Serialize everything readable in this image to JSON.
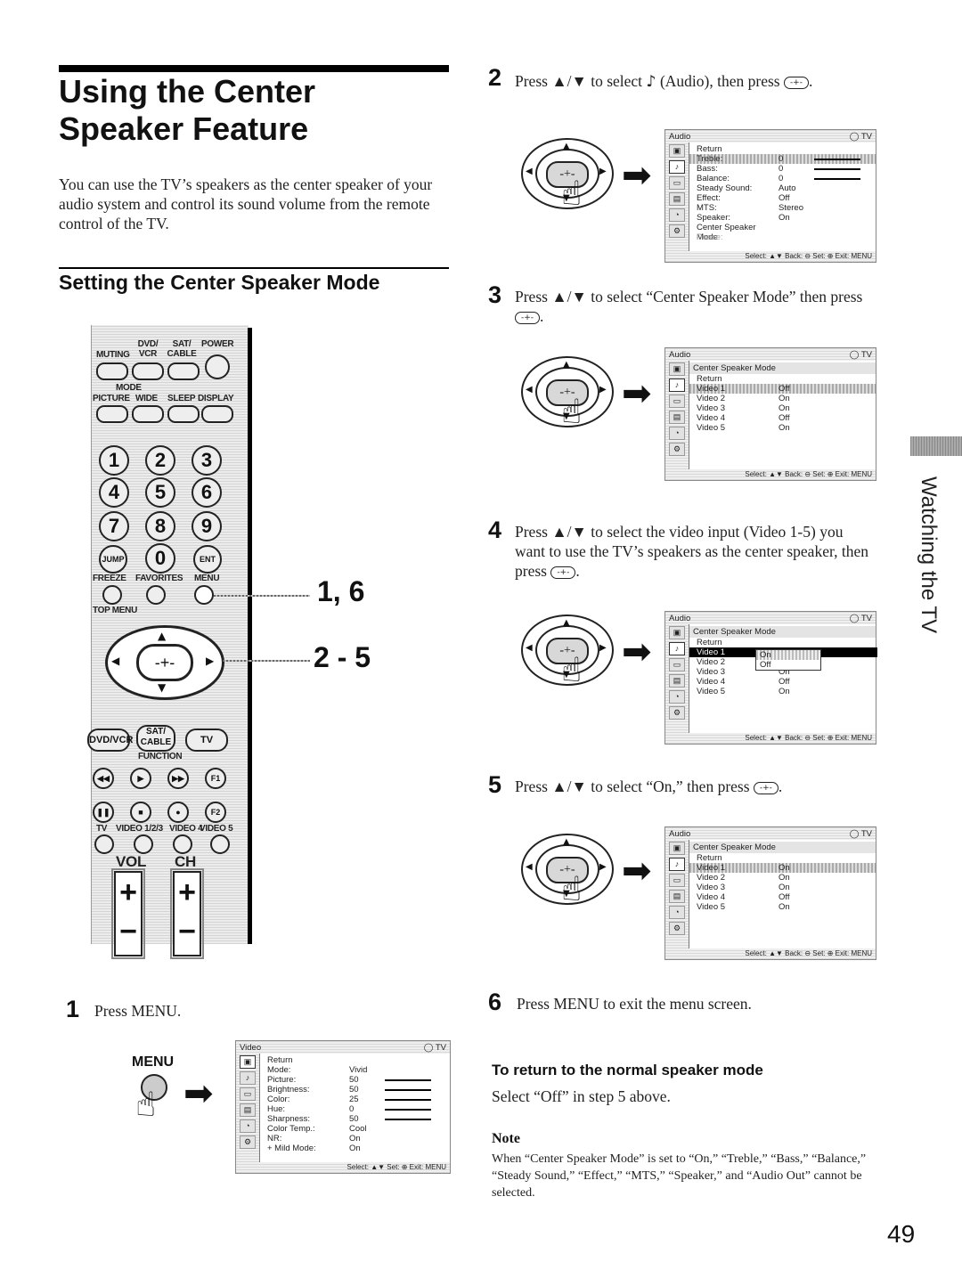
{
  "header": {
    "title_line1": "Using the Center",
    "title_line2": "Speaker Feature",
    "intro": "You can use the TV’s speakers as the center speaker of your audio system and control its sound volume from the remote control of the TV.",
    "subtitle": "Setting the Center Speaker Mode"
  },
  "remote": {
    "top_labels": [
      "MUTING",
      "DVD/ VCR",
      "SAT/ CABLE",
      "POWER"
    ],
    "mode_label": "MODE",
    "mode_labels": [
      "PICTURE",
      "WIDE",
      "SLEEP",
      "DISPLAY"
    ],
    "numbers": [
      "1",
      "2",
      "3",
      "4",
      "5",
      "6",
      "7",
      "8",
      "9"
    ],
    "jump": "JUMP",
    "zero": "0",
    "ent": "ENT",
    "row_labels": [
      "FREEZE",
      "FAVORITES",
      "MENU"
    ],
    "top_menu": "TOP MENU",
    "function_buttons": [
      "DVD/VCR",
      "SAT/ CABLE",
      "TV"
    ],
    "function_label": "FUNCTION",
    "transport_row1": [
      "◀◀",
      "▶",
      "▶▶",
      "F1"
    ],
    "transport_row2": [
      "❚❚",
      "■",
      "●",
      "F2"
    ],
    "input_labels": [
      "TV",
      "VIDEO 1/2/3",
      "VIDEO 4",
      "VIDEO 5"
    ],
    "vol": "VOL",
    "ch": "CH",
    "plus": "+",
    "minus": "−",
    "enter_glyph": "-+-",
    "arrows": {
      "up": "▲",
      "down": "▼",
      "left": "◀",
      "right": "▶"
    }
  },
  "callouts": [
    "1, 6",
    "2 - 5"
  ],
  "steps": [
    {
      "num": "1",
      "text": "Press MENU."
    },
    {
      "num": "2",
      "pre": "Press ▲/▼ to select",
      "icon": "♪",
      "post": "(Audio), then press",
      "end": "."
    },
    {
      "num": "3",
      "text": "Press ▲/▼ to select “Center Speaker Mode” then press",
      "end": "."
    },
    {
      "num": "4",
      "text": "Press ▲/▼ to select the video input (Video 1-5) you want to use the TV’s speakers as the center speaker, then press",
      "end": "."
    },
    {
      "num": "5",
      "text": "Press ▲/▼ to select “On,” then press",
      "end": "."
    },
    {
      "num": "6",
      "text": "Press MENU to exit the menu screen."
    }
  ],
  "menu_button_label": "MENU",
  "enter_glyph": "-+-",
  "hand_glyph": "☝",
  "arrow_glyph": "➡",
  "screens": {
    "video": {
      "header": "Video",
      "tv": "◯ TV",
      "rows": [
        {
          "k": "Return",
          "v": ""
        },
        {
          "k": "Mode:",
          "v": "Vivid"
        },
        {
          "k": "  Picture:",
          "v": "50",
          "bar": true
        },
        {
          "k": "  Brightness:",
          "v": "50",
          "bar": true
        },
        {
          "k": "  Color:",
          "v": "25",
          "bar": true
        },
        {
          "k": "  Hue:",
          "v": "0",
          "bar": true
        },
        {
          "k": "  Sharpness:",
          "v": "50",
          "bar": true
        },
        {
          "k": "  Color Temp.:",
          "v": "Cool"
        },
        {
          "k": "  NR:",
          "v": "On"
        },
        {
          "k": "+ Mild Mode:",
          "v": "On"
        }
      ],
      "footer": "Select: ▲▼  Set: ⊕  Exit: MENU"
    },
    "audio": {
      "header": "Audio",
      "tv": "◯ TV",
      "rows": [
        {
          "k": "Return",
          "v": ""
        },
        {
          "k": "Treble:",
          "v": "0",
          "bar": true,
          "hl": true
        },
        {
          "k": "Bass:",
          "v": "0",
          "bar": true
        },
        {
          "k": "Balance:",
          "v": "0",
          "bar": true
        },
        {
          "k": "Steady Sound:",
          "v": "Auto"
        },
        {
          "k": "Effect:",
          "v": "Off"
        },
        {
          "k": "MTS:",
          "v": "Stereo"
        },
        {
          "k": "Speaker:",
          "v": "On"
        },
        {
          "k": "Center Speaker Mode",
          "v": ""
        },
        {
          "k": "Phase:",
          "v": "",
          "dim": true
        }
      ],
      "footer": "Select: ▲▼  Back: ⊖  Set: ⊕  Exit: MENU"
    },
    "center_step3": {
      "header": "Audio",
      "tv": "◯ TV",
      "sub": "Center Speaker Mode",
      "rows": [
        {
          "k": "Return",
          "v": ""
        },
        {
          "k": "Video 1",
          "v": "Off",
          "hl": true
        },
        {
          "k": "Video 2",
          "v": "On"
        },
        {
          "k": "Video 3",
          "v": "On"
        },
        {
          "k": "Video 4",
          "v": "Off"
        },
        {
          "k": "Video 5",
          "v": "On"
        }
      ],
      "footer": "Select: ▲▼  Back: ⊖  Set: ⊕  Exit: MENU"
    },
    "center_step4": {
      "header": "Audio",
      "tv": "◯ TV",
      "sub": "Center Speaker Mode",
      "rows": [
        {
          "k": "Return",
          "v": ""
        },
        {
          "k": "Video 1",
          "v": "",
          "sel": true
        },
        {
          "k": "Video 2",
          "v": ""
        },
        {
          "k": "Video 3",
          "v": "On"
        },
        {
          "k": "Video 4",
          "v": "Off"
        },
        {
          "k": "Video 5",
          "v": "On"
        }
      ],
      "popup": [
        "On",
        "Off"
      ],
      "footer": "Select: ▲▼  Back: ⊖  Set: ⊕  Exit: MENU"
    },
    "center_step5": {
      "header": "Audio",
      "tv": "◯ TV",
      "sub": "Center Speaker Mode",
      "rows": [
        {
          "k": "Return",
          "v": ""
        },
        {
          "k": "Video 1",
          "v": "On",
          "hl": true
        },
        {
          "k": "Video 2",
          "v": "On"
        },
        {
          "k": "Video 3",
          "v": "On"
        },
        {
          "k": "Video 4",
          "v": "Off"
        },
        {
          "k": "Video 5",
          "v": "On"
        }
      ],
      "footer": "Select: ▲▼  Back: ⊖  Set: ⊕  Exit: MENU"
    }
  },
  "return_section": {
    "heading": "To return to the normal speaker mode",
    "text": "Select “Off” in step 5 above."
  },
  "note": {
    "heading": "Note",
    "text": "When “Center Speaker Mode” is set to “On,” “Treble,” “Bass,” “Balance,” “Steady Sound,” “Effect,” “MTS,” “Speaker,” and “Audio Out” cannot be selected."
  },
  "side_tab": "Watching the TV",
  "page_number": "49"
}
